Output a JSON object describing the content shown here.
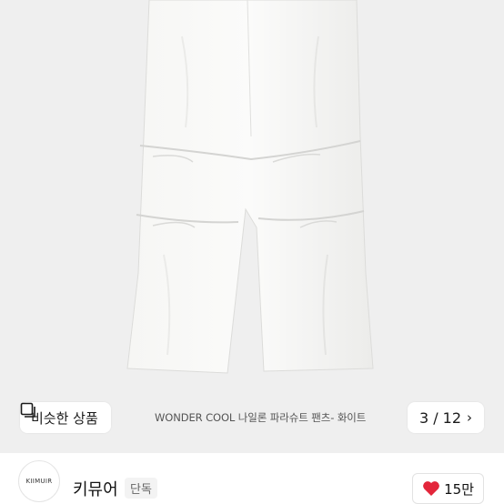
{
  "product": {
    "caption": "WONDER COOL 나일론 파라슈트 팬츠- 화이트",
    "similar_label": "비슷한 상품",
    "pager": "3 / 12"
  },
  "shop": {
    "avatar_text": "KIIMUIR",
    "name": "키뮤어",
    "badge": "단독",
    "likes": "15만"
  },
  "colors": {
    "background": "#efefef",
    "heart": "#e3263b"
  },
  "icons": {
    "similar": "similar-products-icon",
    "chevron": "chevron-right-icon",
    "heart": "heart-icon"
  }
}
